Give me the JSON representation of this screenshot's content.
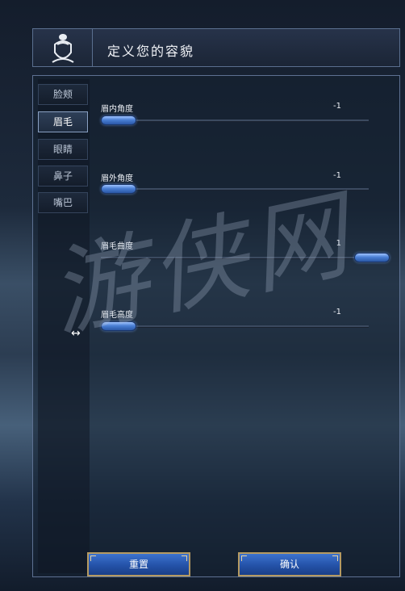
{
  "header": {
    "title": "定义您的容貌",
    "avatar_icon": "face-avatar-icon"
  },
  "tabs": [
    {
      "label": "脸颊",
      "active": false
    },
    {
      "label": "眉毛",
      "active": true
    },
    {
      "label": "眼睛",
      "active": false
    },
    {
      "label": "鼻子",
      "active": false
    },
    {
      "label": "嘴巴",
      "active": false
    }
  ],
  "sliders": [
    {
      "label": "眉内角度",
      "value": "-1",
      "level": 0
    },
    {
      "label": "眉外角度",
      "value": "-1",
      "level": 0
    },
    {
      "label": "眉毛曲度",
      "value": "1",
      "level": 1
    },
    {
      "label": "眉毛高度",
      "value": "-1",
      "level": 0
    }
  ],
  "buttons": {
    "reset": "重置",
    "confirm": "确认"
  },
  "watermark": "游侠网"
}
